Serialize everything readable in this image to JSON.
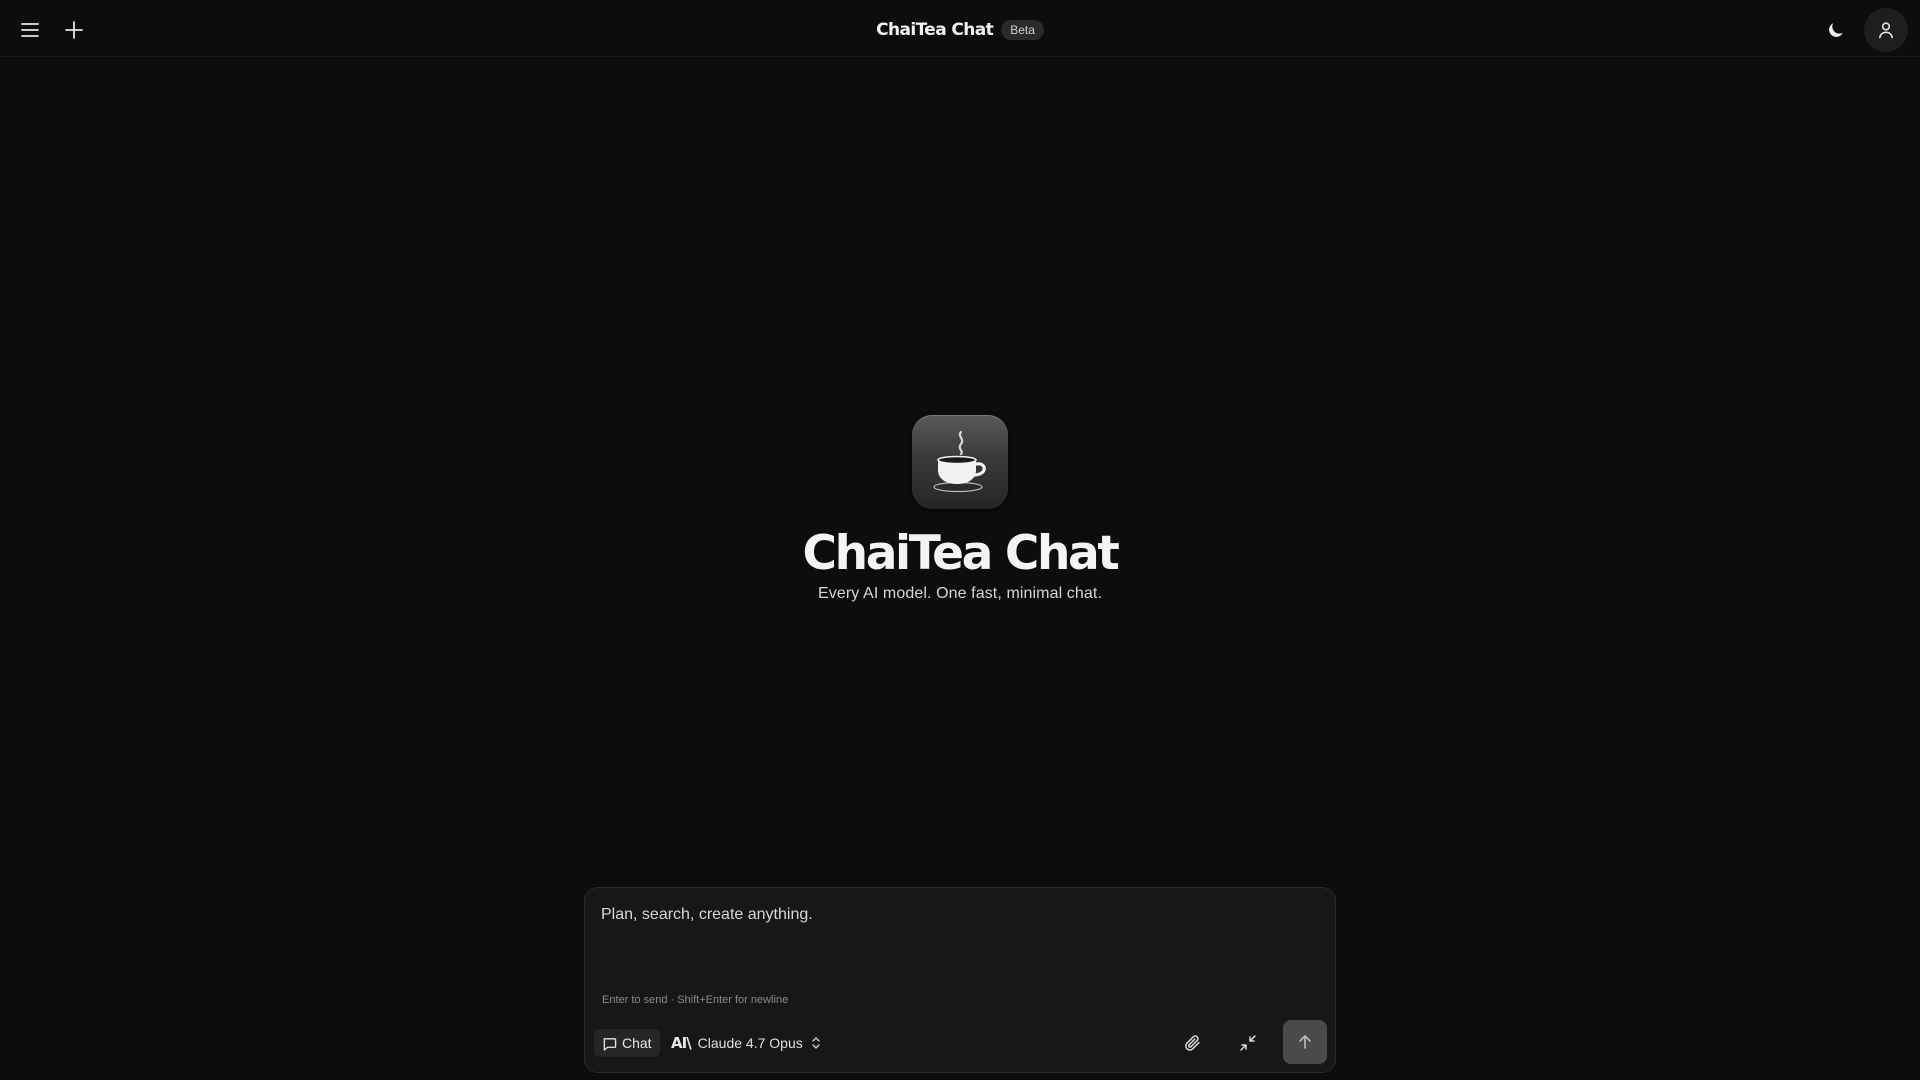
{
  "app": {
    "title": "ChaiTea Chat",
    "badge": "Beta"
  },
  "header": {
    "icons": [
      "menu-icon",
      "plus-icon",
      "moon-icon",
      "user-icon"
    ]
  },
  "hero": {
    "logo_icon": "tea-cup-icon",
    "title": "ChaiTea Chat",
    "tagline": "Every AI model. One fast, minimal chat."
  },
  "composer": {
    "placeholder": "Plan, search, create anything.",
    "value": "",
    "hint": "Enter to send · Shift+Enter for newline",
    "mode_label": "Chat",
    "model_label": "Claude 4.7 Opus",
    "model_logo": "AI\\",
    "icons": [
      "chat-bubble-icon",
      "anthropic-logo-icon",
      "chevron-updown-icon",
      "paperclip-icon",
      "collapse-icon",
      "arrow-up-icon"
    ]
  },
  "colors": {
    "background": "#0d0d0d",
    "composer_bg": "#171717",
    "send_button": "#4a4a4a",
    "text": "#e8e8e8"
  }
}
